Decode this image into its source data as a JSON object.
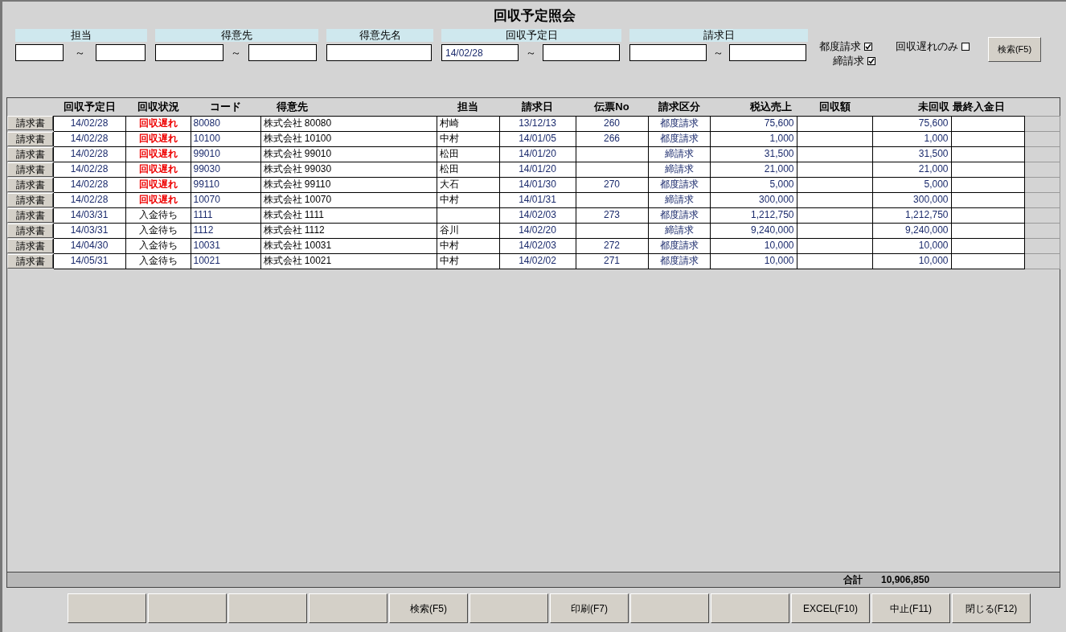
{
  "window": {
    "title": "回収予定照会"
  },
  "filters": [
    {
      "label": "担当",
      "separator": "～"
    },
    {
      "label": "得意先",
      "separator": "～"
    },
    {
      "label": "得意先名"
    },
    {
      "label": "回収予定日",
      "separator": "～",
      "from_value": "14/02/28"
    },
    {
      "label": "請求日",
      "separator": "～"
    }
  ],
  "checkboxes": [
    {
      "label": "都度請求",
      "checked": true
    },
    {
      "label": "締請求",
      "checked": true
    },
    {
      "label": "回収遅れのみ",
      "checked": false
    }
  ],
  "search_button": "検索(F5)",
  "table": {
    "columns": [
      "回収予定日",
      "回収状況",
      "コード",
      "得意先",
      "担当",
      "請求日",
      "伝票No",
      "請求区分",
      "税込売上",
      "回収額",
      "未回収",
      "最終入金日"
    ],
    "rows": [
      {
        "button": "請求書",
        "overdue": true,
        "due_date": "14/02/28",
        "status": "回収遅れ",
        "code": "80080",
        "customer": "株式会社 80080",
        "staff": "村崎",
        "invoice_date": "13/12/13",
        "slip_no": "260",
        "billing_type": "都度請求",
        "sales": "75,600",
        "outstanding": "75,600"
      },
      {
        "button": "請求書",
        "overdue": true,
        "due_date": "14/02/28",
        "status": "回収遅れ",
        "code": "10100",
        "customer": "株式会社 10100",
        "staff": "中村",
        "invoice_date": "14/01/05",
        "slip_no": "266",
        "billing_type": "都度請求",
        "sales": "1,000",
        "outstanding": "1,000"
      },
      {
        "button": "請求書",
        "overdue": true,
        "due_date": "14/02/28",
        "status": "回収遅れ",
        "code": "99010",
        "customer": "株式会社 99010",
        "staff": "松田",
        "invoice_date": "14/01/20",
        "billing_type": "締請求",
        "sales": "31,500",
        "outstanding": "31,500"
      },
      {
        "button": "請求書",
        "overdue": true,
        "due_date": "14/02/28",
        "status": "回収遅れ",
        "code": "99030",
        "customer": "株式会社 99030",
        "staff": "松田",
        "invoice_date": "14/01/20",
        "billing_type": "締請求",
        "sales": "21,000",
        "outstanding": "21,000"
      },
      {
        "button": "請求書",
        "overdue": true,
        "due_date": "14/02/28",
        "status": "回収遅れ",
        "code": "99110",
        "customer": "株式会社 99110",
        "staff": "大石",
        "invoice_date": "14/01/30",
        "slip_no": "270",
        "billing_type": "都度請求",
        "sales": "5,000",
        "outstanding": "5,000"
      },
      {
        "button": "請求書",
        "overdue": true,
        "due_date": "14/02/28",
        "status": "回収遅れ",
        "code": "10070",
        "customer": "株式会社 10070",
        "staff": "中村",
        "invoice_date": "14/01/31",
        "billing_type": "締請求",
        "sales": "300,000",
        "outstanding": "300,000"
      },
      {
        "button": "請求書",
        "overdue": false,
        "due_date": "14/03/31",
        "status": "入金待ち",
        "code": "1111",
        "customer": "株式会社 1111",
        "invoice_date": "14/02/03",
        "slip_no": "273",
        "billing_type": "都度請求",
        "sales": "1,212,750",
        "outstanding": "1,212,750"
      },
      {
        "button": "請求書",
        "overdue": false,
        "due_date": "14/03/31",
        "status": "入金待ち",
        "code": "1112",
        "customer": "株式会社 1112",
        "staff": "谷川",
        "invoice_date": "14/02/20",
        "billing_type": "締請求",
        "sales": "9,240,000",
        "outstanding": "9,240,000"
      },
      {
        "button": "請求書",
        "overdue": false,
        "due_date": "14/04/30",
        "status": "入金待ち",
        "code": "10031",
        "customer": "株式会社 10031",
        "staff": "中村",
        "invoice_date": "14/02/03",
        "slip_no": "272",
        "billing_type": "都度請求",
        "sales": "10,000",
        "outstanding": "10,000"
      },
      {
        "button": "請求書",
        "overdue": false,
        "due_date": "14/05/31",
        "status": "入金待ち",
        "code": "10021",
        "customer": "株式会社 10021",
        "staff": "中村",
        "invoice_date": "14/02/02",
        "slip_no": "271",
        "billing_type": "都度請求",
        "sales": "10,000",
        "outstanding": "10,000"
      }
    ]
  },
  "total": {
    "label": "合計",
    "value": "10,906,850"
  },
  "function_keys": [
    {
      "kind": "blank"
    },
    {
      "kind": "blank"
    },
    {
      "kind": "blank"
    },
    {
      "kind": "blank"
    },
    {
      "kind": "key",
      "label": "検索(F5)"
    },
    {
      "kind": "blank"
    },
    {
      "kind": "key",
      "label": "印刷(F7)"
    },
    {
      "kind": "blank"
    },
    {
      "kind": "blank"
    },
    {
      "kind": "key",
      "label": "EXCEL(F10)"
    },
    {
      "kind": "key",
      "label": "中止(F11)"
    },
    {
      "kind": "key",
      "label": "閉じる(F12)"
    }
  ]
}
